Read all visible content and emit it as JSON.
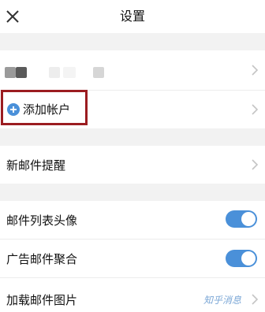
{
  "header": {
    "title": "设置",
    "close_icon": "close-icon"
  },
  "account": {
    "masked_name": "",
    "add_account_label": "添加帐户",
    "add_icon": "plus-circle-icon"
  },
  "settings": {
    "new_mail_reminder": "新邮件提醒",
    "list_avatar": "邮件列表头像",
    "list_avatar_on": true,
    "ad_aggregate": "广告邮件聚合",
    "ad_aggregate_on": true,
    "load_images": "加载邮件图片"
  },
  "watermark": "知乎消息",
  "colors": {
    "toggle_on": "#4a90d9",
    "highlight_border": "#9b1c20",
    "add_icon": "#4a90d9",
    "section_gap": "#f2f2f2"
  }
}
